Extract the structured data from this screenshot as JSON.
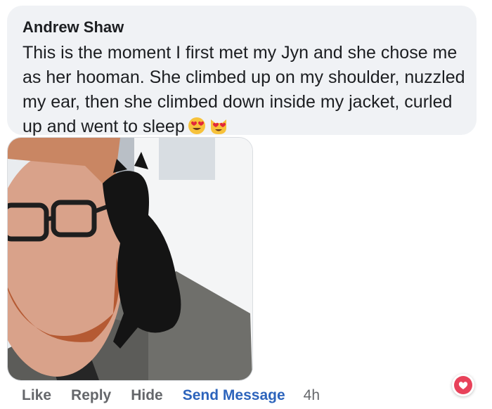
{
  "comment": {
    "author": "Andrew Shaw",
    "text": "This is the moment I first met my Jyn and she chose me as her hooman. She climbed up on my shoulder, nuzzled my ear, then she climbed down inside my jacket, curled up and went to sleep",
    "emojis": [
      "smiling-face-with-heart-eyes",
      "smiling-cat-with-heart-eyes"
    ]
  },
  "actions": {
    "like": "Like",
    "reply": "Reply",
    "hide": "Hide",
    "send_message": "Send Message",
    "time": "4h"
  },
  "reaction": {
    "icon": "heart-reaction-icon",
    "color": "#e8425a"
  },
  "colors": {
    "bubble": "#f0f2f5",
    "link": "#2d64bc",
    "muted": "#65676b"
  }
}
